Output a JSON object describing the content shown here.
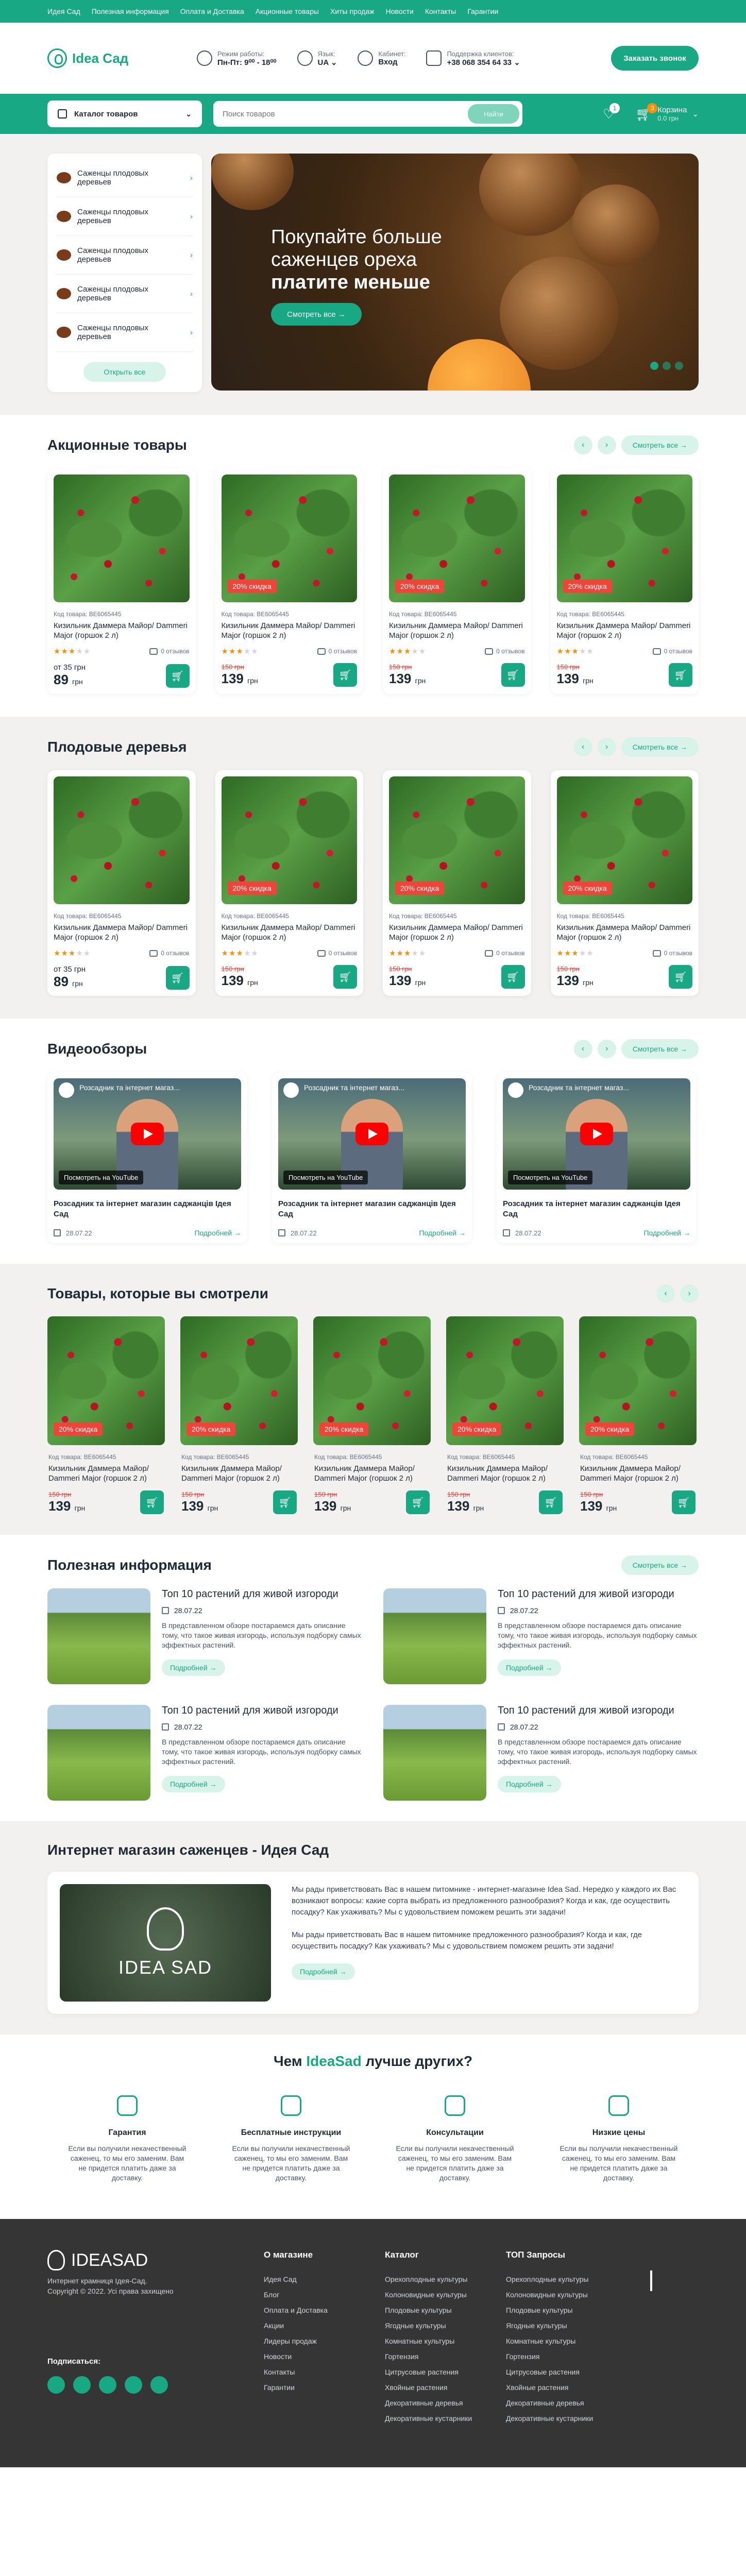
{
  "topbar": {
    "links": [
      "Идея Сад",
      "Полезная информация",
      "Оплата и Доставка",
      "Акционные товары",
      "Хиты продаж",
      "Новости",
      "Контакты",
      "Гарантии"
    ]
  },
  "header": {
    "logo": "Idea Сад",
    "hours_label": "Режим работы:",
    "hours_value": "Пн-Пт: 9⁰⁰ - 18⁰⁰",
    "lang_label": "Язык:",
    "lang_value": "UA",
    "cabinet_label": "Кабинет:",
    "cabinet_value": "Вход",
    "support_label": "Поддержка клиентов:",
    "support_value": "+38 068 354 64 33",
    "call_button": "Заказать звонок"
  },
  "nav": {
    "catalog": "Каталог товаров",
    "search_placeholder": "Поиск товаров",
    "search_button": "Найти",
    "fav_count": "1",
    "cart_count": "3",
    "cart_label": "Корзина",
    "cart_sum": "0.0 грн"
  },
  "hero": {
    "side_items": [
      "Саженцы плодовых деревьев",
      "Саженцы плодовых деревьев",
      "Саженцы плодовых деревьев",
      "Саженцы плодовых деревьев",
      "Саженцы плодовых деревьев"
    ],
    "open_all": "Открыть все",
    "title_line1": "Покупайте больше саженцев ореха",
    "title_line2": "платите меньше",
    "cta": "Смотреть все"
  },
  "labels": {
    "code": "Код товара:",
    "reviews": "0 отзывов",
    "currency": "грн",
    "from": "от",
    "see_all": "Смотреть все",
    "more": "Подробней"
  },
  "promo": {
    "title": "Акционные товары",
    "products": [
      {
        "code": "BE6065445",
        "name": "Кизильник Даммера Майор/ Dammeri Major (горшок 2 л)",
        "stars": 3,
        "discount": "",
        "old_price": "",
        "price": "89",
        "from": "от 35 грн"
      },
      {
        "code": "BE6065445",
        "name": "Кизильник Даммера Майор/ Dammeri Major (горшок 2 л)",
        "stars": 3,
        "discount": "20% скидка",
        "old_price": "150 грн",
        "price": "139",
        "from": ""
      },
      {
        "code": "BE6065445",
        "name": "Кизильник Даммера Майор/ Dammeri Major (горшок 2 л)",
        "stars": 3,
        "discount": "20% скидка",
        "old_price": "150 грн",
        "price": "139",
        "from": ""
      },
      {
        "code": "BE6065445",
        "name": "Кизильник Даммера Майор/ Dammeri Major (горшок 2 л)",
        "stars": 3,
        "discount": "20% скидка",
        "old_price": "150 грн",
        "price": "139",
        "from": ""
      }
    ]
  },
  "fruit": {
    "title": "Плодовые деревья",
    "products": [
      {
        "code": "BE6065445",
        "name": "Кизильник Даммера Майор/ Dammeri Major (горшок 2 л)",
        "stars": 3,
        "discount": "",
        "old_price": "",
        "price": "89",
        "from": "от 35 грн"
      },
      {
        "code": "BE6065445",
        "name": "Кизильник Даммера Майор/ Dammeri Major (горшок 2 л)",
        "stars": 3,
        "discount": "20% скидка",
        "old_price": "150 грн",
        "price": "139",
        "from": ""
      },
      {
        "code": "BE6065445",
        "name": "Кизильник Даммера Майор/ Dammeri Major (горшок 2 л)",
        "stars": 3,
        "discount": "20% скидка",
        "old_price": "150 грн",
        "price": "139",
        "from": ""
      },
      {
        "code": "BE6065445",
        "name": "Кизильник Даммера Майор/ Dammeri Major (горшок 2 л)",
        "stars": 3,
        "discount": "20% скидка",
        "old_price": "150 грн",
        "price": "139",
        "from": ""
      }
    ]
  },
  "videos": {
    "title": "Видеообзоры",
    "items": [
      {
        "thumb_title": "Розсадник та інтернет магаз...",
        "watch": "Посмотреть на YouTube",
        "name": "Розсадник та інтернет магазин саджанців Ідея Сад",
        "date": "28.07.22"
      },
      {
        "thumb_title": "Розсадник та інтернет магаз...",
        "watch": "Посмотреть на YouTube",
        "name": "Розсадник та інтернет магазин саджанців Ідея Сад",
        "date": "28.07.22"
      },
      {
        "thumb_title": "Розсадник та інтернет магаз...",
        "watch": "Посмотреть на YouTube",
        "name": "Розсадник та інтернет магазин саджанців Ідея Сад",
        "date": "28.07.22"
      }
    ]
  },
  "viewed": {
    "title": "Товары, которые вы смотрели",
    "products": [
      {
        "code": "BE6065445",
        "name": "Кизильник Даммера Майор/ Dammeri Major (горшок 2 л)",
        "discount": "20% скидка",
        "old_price": "150 грн",
        "price": "139"
      },
      {
        "code": "BE6065445",
        "name": "Кизильник Даммера Майор/ Dammeri Major (горшок 2 л)",
        "discount": "20% скидка",
        "old_price": "150 грн",
        "price": "139"
      },
      {
        "code": "BE6065445",
        "name": "Кизильник Даммера Майор/ Dammeri Major (горшок 2 л)",
        "discount": "20% скидка",
        "old_price": "150 грн",
        "price": "139"
      },
      {
        "code": "BE6065445",
        "name": "Кизильник Даммера Майор/ Dammeri Major (горшок 2 л)",
        "discount": "20% скидка",
        "old_price": "150 грн",
        "price": "139"
      },
      {
        "code": "BE6065445",
        "name": "Кизильник Даммера Майор/ Dammeri Major (горшок 2 л)",
        "discount": "20% скидка",
        "old_price": "150 грн",
        "price": "139"
      }
    ]
  },
  "info": {
    "title": "Полезная информация",
    "items": [
      {
        "title": "Топ 10 растений для живой изгороди",
        "date": "28.07.22",
        "text": "В представленном обзоре постараемся дать описание тому, что такое живая изгородь, используя подборку самых эффектных растений."
      },
      {
        "title": "Топ 10 растений для живой изгороди",
        "date": "28.07.22",
        "text": "В представленном обзоре постараемся дать описание тому, что такое живая изгородь, используя подборку самых эффектных растений."
      },
      {
        "title": "Топ 10 растений для живой изгороди",
        "date": "28.07.22",
        "text": "В представленном обзоре постараемся дать описание тому, что такое живая изгородь, используя подборку самых эффектных растений."
      },
      {
        "title": "Топ 10 растений для живой изгороди",
        "date": "28.07.22",
        "text": "В представленном обзоре постараемся дать описание тому, что такое живая изгородь, используя подборку самых эффектных растений."
      }
    ]
  },
  "about": {
    "title": "Интернет магазин саженцев - Идея Сад",
    "logo_text": "IDEA SAD",
    "p1": "Мы рады приветствовать Вас в нашем питомнике - интернет-магазине Idea Sad. Нередко у каждого их Вас возникают вопросы: какие сорта выбрать из предложенного разнообразия? Когда и как, где осуществить посадку? Как ухаживать? Мы с удовольствием поможем решить эти задачи!",
    "p2": "Мы рады приветствовать Вас в нашем питомнике предложенного разнообразия? Когда и как, где осуществить посадку? Как ухаживать? Мы с удовольствием поможем решить эти задачи!"
  },
  "why": {
    "title_pre": "Чем",
    "title_brand": "IdeaSad",
    "title_post": "лучше других?",
    "items": [
      {
        "title": "Гарантия",
        "text": "Если вы получили некачественный саженец, то мы его заменим. Вам не придется платить даже за доставку."
      },
      {
        "title": "Бесплатные инструкции",
        "text": "Если вы получили некачественный саженец, то мы его заменим. Вам не придется платить даже за доставку."
      },
      {
        "title": "Консультации",
        "text": "Если вы получили некачественный саженец, то мы его заменим. Вам не придется платить даже за доставку."
      },
      {
        "title": "Низкие цены",
        "text": "Если вы получили некачественный саженец, то мы его заменим. Вам не придется платить даже за доставку."
      }
    ]
  },
  "footer": {
    "logo": "IDEASAD",
    "tagline": "Интернет крамниця Ідея-Сад.",
    "copyright": "Copyright © 2022. Усі права захищено",
    "subscribe": "Подписаться:",
    "col1": {
      "title": "О магазине",
      "links": [
        "Идея Сад",
        "Блог",
        "Оплата и Доставка",
        "Акции",
        "Лидеры продаж",
        "Новости",
        "Контакты",
        "Гарантии"
      ]
    },
    "col2": {
      "title": "Каталог",
      "links": [
        "Орехоплодные культуры",
        "Колоновидные культуры",
        "Плодовые культуры",
        "Ягодные культуры",
        "Комнатные культуры",
        "Гортензия",
        "Цитрусовые растения",
        "Хвойные растения",
        "Декоративные деревья",
        "Декоративные кустарники"
      ]
    },
    "col3": {
      "title": "ТОП Запросы",
      "links": [
        "Орехоплодные культуры",
        "Колоновидные культуры",
        "Плодовые культуры",
        "Ягодные культуры",
        "Комнатные культуры",
        "Гортензия",
        "Цитрусовые растения",
        "Хвойные растения",
        "Декоративные деревья",
        "Декоративные кустарники"
      ]
    }
  },
  "colors": {
    "accent": "#18a883",
    "sale": "#f04438",
    "footer": "#363535"
  }
}
